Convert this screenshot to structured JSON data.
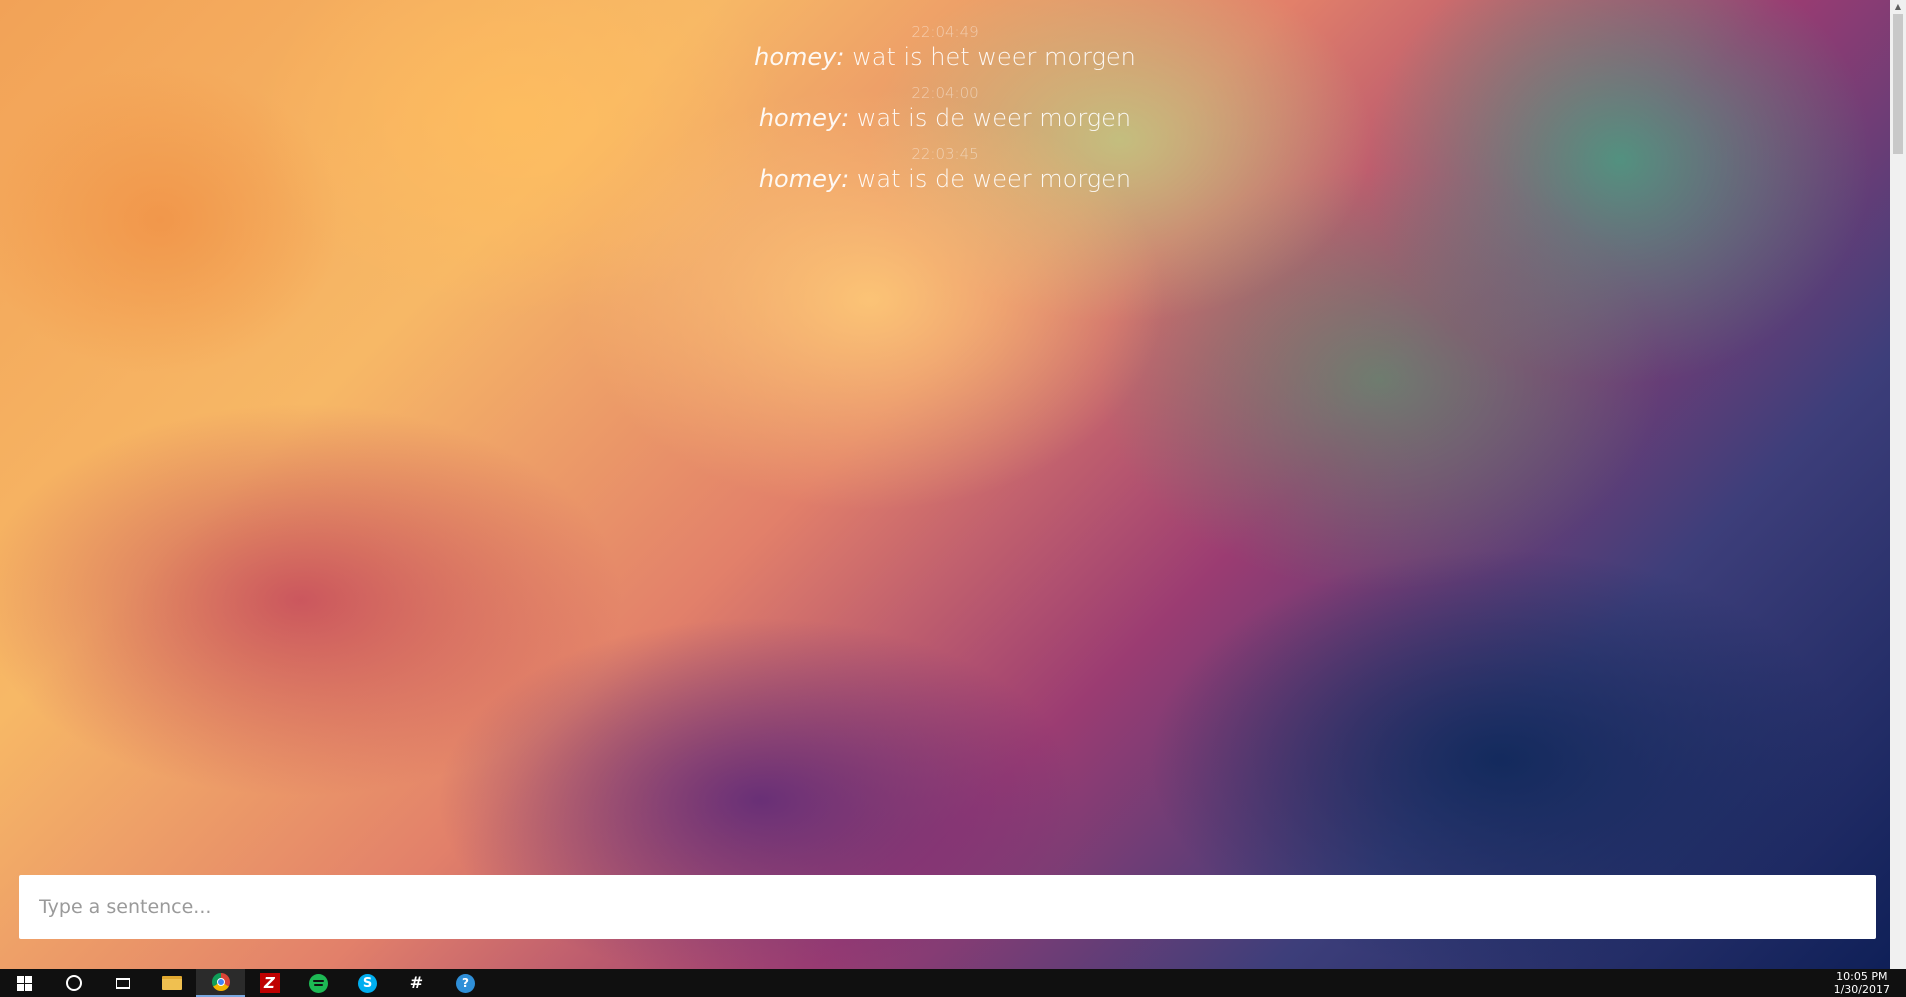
{
  "chat": {
    "messages": [
      {
        "time": "22:04:49",
        "sender": "homey:",
        "text": "wat is het weer morgen"
      },
      {
        "time": "22:04:00",
        "sender": "homey:",
        "text": "wat is de weer morgen"
      },
      {
        "time": "22:03:45",
        "sender": "homey:",
        "text": "wat is de weer morgen"
      }
    ]
  },
  "input": {
    "placeholder": "Type a sentence..."
  },
  "taskbar": {
    "apps": [
      {
        "name": "start",
        "icon": "windows-icon"
      },
      {
        "name": "search",
        "icon": "search-icon"
      },
      {
        "name": "task-view",
        "icon": "task-view-icon"
      },
      {
        "name": "file-explorer",
        "icon": "folder-icon"
      },
      {
        "name": "chrome",
        "icon": "chrome-icon",
        "active": true
      },
      {
        "name": "filezilla",
        "icon": "filezilla-icon",
        "glyph": "Z"
      },
      {
        "name": "spotify",
        "icon": "spotify-icon"
      },
      {
        "name": "skype",
        "icon": "skype-icon",
        "glyph": "S"
      },
      {
        "name": "slack",
        "icon": "slack-icon",
        "glyph": "#"
      },
      {
        "name": "app",
        "icon": "app-icon",
        "glyph": "?"
      }
    ],
    "clock": {
      "time": "10:05 PM",
      "date": "1/30/2017"
    }
  },
  "colors": {
    "taskbar": "#101010",
    "input_background": "#ffffff",
    "active_underline": "#7aa8e0"
  }
}
